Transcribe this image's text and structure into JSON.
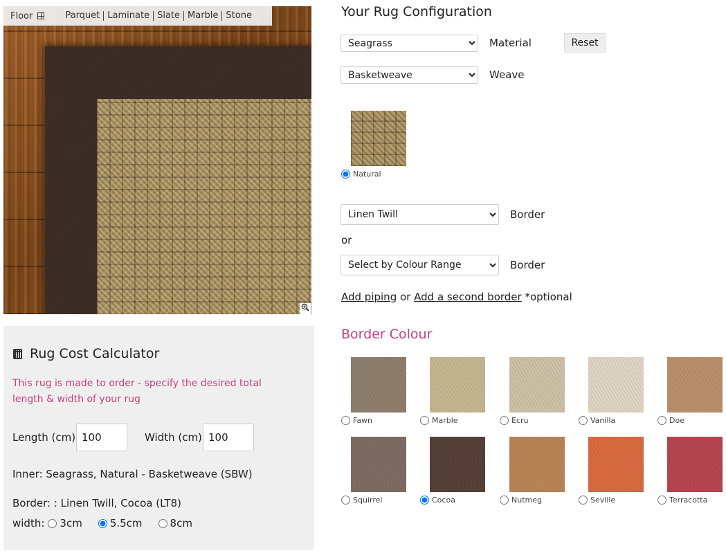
{
  "floor": {
    "label": "Floor",
    "options": [
      "Parquet",
      "Laminate",
      "Slate",
      "Marble",
      "Stone"
    ]
  },
  "icons": {
    "floor": "grid-icon",
    "zoom": "magnifier-plus-icon",
    "calculator": "calculator-icon"
  },
  "config": {
    "title": "Your Rug Configuration",
    "material": {
      "selected": "Seagrass",
      "label": "Material"
    },
    "reset_label": "Reset",
    "weave": {
      "selected": "Basketweave",
      "label": "Weave"
    },
    "inner_colour": {
      "name": "Natural",
      "checked": true
    },
    "border_select": {
      "selected": "Linen Twill",
      "label": "Border"
    },
    "or_text": "or",
    "colour_range": {
      "selected": "Select by Colour Range",
      "label": "Border"
    },
    "links": {
      "piping": "Add piping",
      "or": "or",
      "second_border": "Add a second border",
      "optional": "*optional"
    }
  },
  "border_colour": {
    "title": "Border Colour",
    "swatches": [
      {
        "name": "Fawn",
        "color": "#8b7a69",
        "checked": false
      },
      {
        "name": "Marble",
        "color": "#c3b48d",
        "checked": false
      },
      {
        "name": "Ecru",
        "color": "#cbbfa4",
        "checked": false
      },
      {
        "name": "Vanilla",
        "color": "#ddd3c2",
        "checked": false
      },
      {
        "name": "Doe",
        "color": "#b78c66",
        "checked": false
      },
      {
        "name": "Squirrel",
        "color": "#7a675f",
        "checked": false
      },
      {
        "name": "Cocoa",
        "color": "#4f3a33",
        "checked": true
      },
      {
        "name": "Nutmeg",
        "color": "#b88052",
        "checked": false
      },
      {
        "name": "Seville",
        "color": "#d76638",
        "checked": false
      },
      {
        "name": "Terracotta",
        "color": "#b23f4a",
        "checked": false
      }
    ]
  },
  "calculator": {
    "title": "Rug Cost Calculator",
    "note": "This rug is made to order - specify the desired total length & width of your rug",
    "length_label": "Length (cm)",
    "length_value": "100",
    "width_label": "Width (cm)",
    "width_value": "100",
    "inner_desc": "Inner: Seagrass, Natural - Basketweave (SBW)",
    "border_desc": "Border: : Linen Twill, Cocoa (LT8)",
    "width_choice_label": "width:",
    "width_options": [
      {
        "label": "3cm",
        "checked": false
      },
      {
        "label": "5.5cm",
        "checked": true
      },
      {
        "label": "8cm",
        "checked": false
      }
    ]
  },
  "colors": {
    "accent_pink": "#c53f7d",
    "calc_bg": "#efefef",
    "rug_border": "#3a2a23",
    "rug_inner": "#9e8658"
  }
}
